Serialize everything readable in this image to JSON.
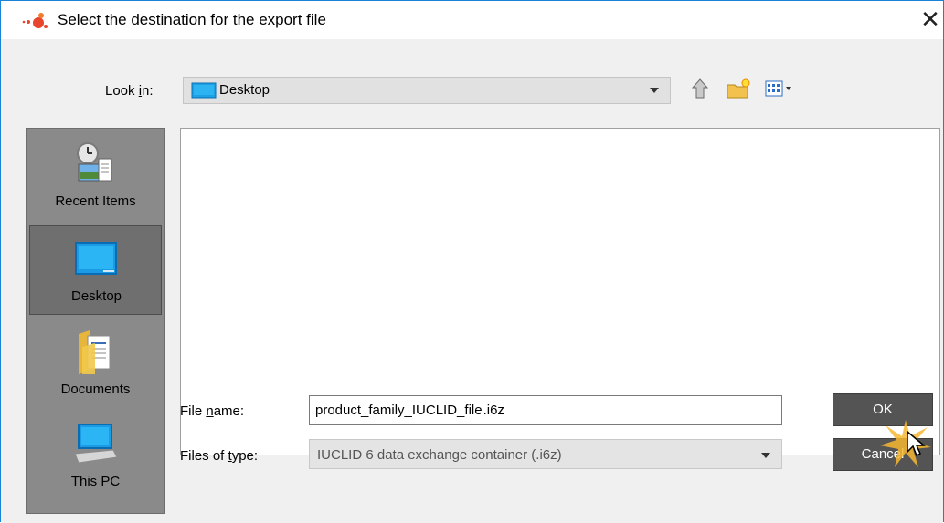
{
  "dialog": {
    "title": "Select the destination for the export file",
    "close_glyph": "✕"
  },
  "lookin": {
    "label_pre": "Look ",
    "label_mnemonic": "i",
    "label_post": "n:",
    "value": "Desktop"
  },
  "toolbar": {
    "up_icon": "up-one-level-icon",
    "new_folder_icon": "new-folder-icon",
    "view_icon": "view-menu-icon"
  },
  "places": [
    {
      "label": "Recent Items",
      "icon": "recent-items-icon",
      "selected": false
    },
    {
      "label": "Desktop",
      "icon": "desktop-icon",
      "selected": true
    },
    {
      "label": "Documents",
      "icon": "documents-icon",
      "selected": false
    },
    {
      "label": "This PC",
      "icon": "this-pc-icon",
      "selected": false
    }
  ],
  "filename": {
    "label_pre": "File ",
    "label_mnemonic": "n",
    "label_post": "ame:",
    "value_before_caret": "product_family_IUCLID_file",
    "value_after_caret": ".i6z"
  },
  "filetype": {
    "label_pre": "Files of ",
    "label_mnemonic": "t",
    "label_post": "ype:",
    "value": "IUCLID 6 data exchange container (.i6z)"
  },
  "buttons": {
    "ok": "OK",
    "cancel": "Cancel"
  },
  "colors": {
    "accent_border": "#1883d7",
    "button_bg": "#545454",
    "places_bg": "#8a8a8a"
  }
}
